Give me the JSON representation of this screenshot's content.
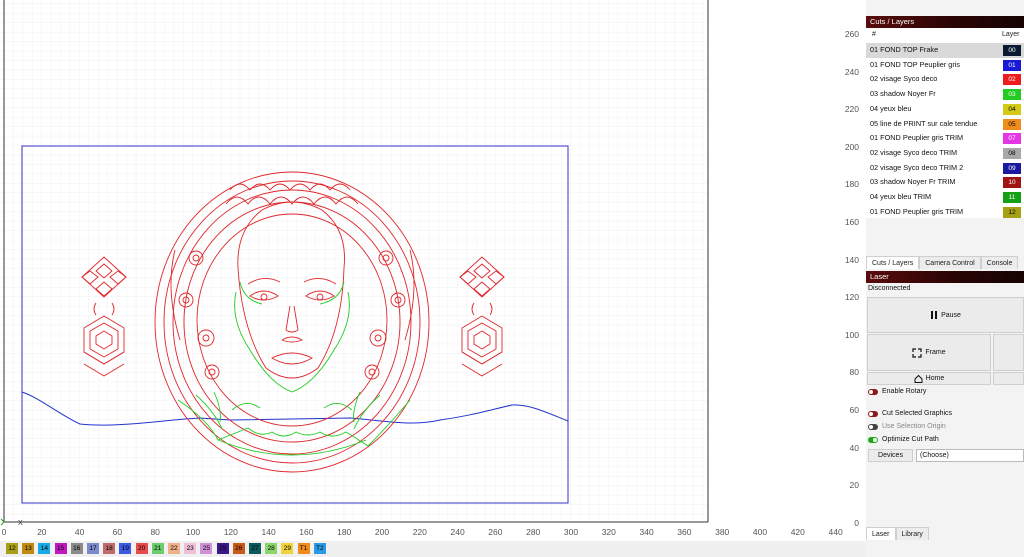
{
  "colors": {
    "accent_title": "#5a0b0b",
    "border_blue": "#3333cc",
    "cut_red": "#e0272b",
    "cut_green": "#22cc22",
    "cut_blue": "#2233cc"
  },
  "canvas": {
    "y_ticks": [
      "260",
      "240",
      "220",
      "200",
      "180",
      "160",
      "140",
      "120",
      "100",
      "80",
      "60",
      "40",
      "20",
      "0"
    ],
    "x_ticks": [
      "0",
      "20",
      "40",
      "60",
      "80",
      "100",
      "120",
      "140",
      "160",
      "180",
      "200",
      "220",
      "240",
      "260",
      "280",
      "300",
      "320",
      "340",
      "360",
      "380",
      "400",
      "420",
      "440"
    ],
    "x_axis_label": "X"
  },
  "cuts_panel": {
    "title": "Cuts / Layers",
    "col_num": "#",
    "col_layer": "Layer",
    "rows": [
      {
        "name": "01 FOND TOP Frake",
        "layer": "00",
        "color": "#0b1a33",
        "text_color": "#ffffff",
        "selected": true
      },
      {
        "name": "01 FOND TOP Peuplier gris",
        "layer": "01",
        "color": "#1a1ad6",
        "text_color": "#ffffff",
        "selected": false
      },
      {
        "name": "02 visage Syco deco",
        "layer": "02",
        "color": "#ee1c1c",
        "text_color": "#ffffff",
        "selected": false
      },
      {
        "name": "03 shadow Noyer Fr",
        "layer": "03",
        "color": "#22cc22",
        "text_color": "#ffffff",
        "selected": false
      },
      {
        "name": "04 yeux bleu",
        "layer": "04",
        "color": "#d4cc14",
        "text_color": "#000000",
        "selected": false
      },
      {
        "name": "05 line de PRINT sur cale tendue",
        "layer": "05",
        "color": "#f08c1c",
        "text_color": "#000000",
        "selected": false
      },
      {
        "name": "01 FOND Peuplier gris TRIM",
        "layer": "07",
        "color": "#e535e5",
        "text_color": "#ffffff",
        "selected": false
      },
      {
        "name": "02 visage Syco deco TRIM",
        "layer": "08",
        "color": "#a8a8a8",
        "text_color": "#000000",
        "selected": false
      },
      {
        "name": "02 visage Syco deco TRIM 2",
        "layer": "09",
        "color": "#1a1aa0",
        "text_color": "#ffffff",
        "selected": false
      },
      {
        "name": "03 shadow Noyer Fr TRIM",
        "layer": "10",
        "color": "#a01414",
        "text_color": "#ffffff",
        "selected": false
      },
      {
        "name": "04 yeux bleu TRIM",
        "layer": "11",
        "color": "#14a014",
        "text_color": "#ffffff",
        "selected": false
      },
      {
        "name": "01 FOND Peuplier gris TRIM",
        "layer": "12",
        "color": "#a8a014",
        "text_color": "#000000",
        "selected": false
      }
    ]
  },
  "top_tabs": [
    "Cuts / Layers",
    "Camera Control",
    "Console"
  ],
  "laser": {
    "title": "Laser",
    "status": "Disconnected",
    "pause": "Pause",
    "frame": "Frame",
    "home": "Home",
    "enable_rotary": "Enable Rotary",
    "cut_selected": "Cut Selected Graphics",
    "use_selection_origin": "Use Selection Origin",
    "optimize": "Optimize Cut Path",
    "devices": "Devices",
    "device_value": "(Choose)"
  },
  "bottom_tabs": [
    "Laser",
    "Library"
  ],
  "palette": [
    {
      "label": "12",
      "color": "#a8a014"
    },
    {
      "label": "13",
      "color": "#c08a10"
    },
    {
      "label": "14",
      "color": "#19a9e6"
    },
    {
      "label": "15",
      "color": "#c018c0"
    },
    {
      "label": "16",
      "color": "#8a8a8a"
    },
    {
      "label": "17",
      "color": "#7a8acc"
    },
    {
      "label": "18",
      "color": "#c06a6a"
    },
    {
      "label": "19",
      "color": "#3a5ae6"
    },
    {
      "label": "20",
      "color": "#e64a4a"
    },
    {
      "label": "21",
      "color": "#6acc6a"
    },
    {
      "label": "22",
      "color": "#f0b08a"
    },
    {
      "label": "23",
      "color": "#f0c0d8"
    },
    {
      "label": "25",
      "color": "#d090d8"
    },
    {
      "label": "25",
      "color": "#3a1a8a"
    },
    {
      "label": "26",
      "color": "#c85a1a"
    },
    {
      "label": "27",
      "color": "#0a5a5a"
    },
    {
      "label": "28",
      "color": "#8ad66a"
    },
    {
      "label": "29",
      "color": "#f0d23a"
    },
    {
      "label": "T1",
      "color": "#f08c1c"
    },
    {
      "label": "T2",
      "color": "#2a9ae6"
    }
  ]
}
